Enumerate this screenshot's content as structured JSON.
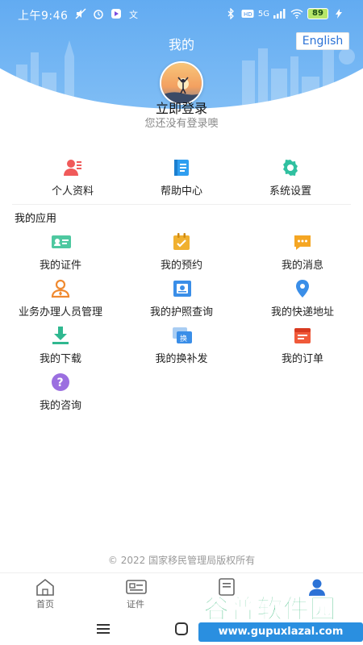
{
  "status_bar": {
    "time": "上午9:46",
    "network_label": "5G",
    "battery": "89"
  },
  "header": {
    "title": "我的",
    "lang_button": "English"
  },
  "profile": {
    "login_title": "立即登录",
    "login_subtitle": "您还没有登录噢"
  },
  "quick_links": [
    {
      "label": "个人资料",
      "icon": "profile-icon",
      "color": "#f05a5a"
    },
    {
      "label": "帮助中心",
      "icon": "help-book-icon",
      "color": "#2f9ef0"
    },
    {
      "label": "系统设置",
      "icon": "settings-gear-icon",
      "color": "#30c0a0"
    }
  ],
  "apps_section": {
    "title": "我的应用",
    "items": [
      {
        "label": "我的证件",
        "icon": "id-card-icon",
        "color": "#4ec8a0"
      },
      {
        "label": "我的预约",
        "icon": "appointment-icon",
        "color": "#f0b030"
      },
      {
        "label": "我的消息",
        "icon": "message-icon",
        "color": "#f5a623"
      },
      {
        "label": "业务办理人员管理",
        "icon": "staff-manage-icon",
        "color": "#f08a30"
      },
      {
        "label": "我的护照查询",
        "icon": "passport-query-icon",
        "color": "#3a8ee8"
      },
      {
        "label": "我的快递地址",
        "icon": "location-pin-icon",
        "color": "#3a8ee8"
      },
      {
        "label": "我的下载",
        "icon": "download-icon",
        "color": "#30b890"
      },
      {
        "label": "我的换补发",
        "icon": "reissue-icon",
        "color": "#3a8ee8"
      },
      {
        "label": "我的订单",
        "icon": "order-icon",
        "color": "#f05a3a"
      },
      {
        "label": "我的咨询",
        "icon": "question-icon",
        "color": "#9b6fe0"
      }
    ]
  },
  "copyright": "© 2022 国家移民管理局版权所有",
  "bottom_nav": [
    {
      "label": "首页",
      "icon": "home-icon"
    },
    {
      "label": "证件",
      "icon": "certificate-icon"
    },
    {
      "label": "",
      "icon": "news-icon"
    },
    {
      "label": "",
      "icon": "user-icon"
    }
  ],
  "watermark": {
    "title": "谷普软件园",
    "url": "www.gupuxlazal.com"
  },
  "colors": {
    "header_blue": "#4a9bec",
    "accent_blue": "#2b72d6",
    "nav_active": "#2b72d6"
  }
}
